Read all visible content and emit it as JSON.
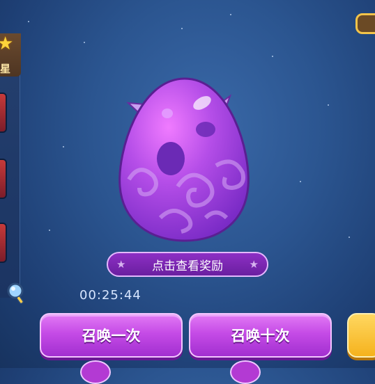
{
  "side_panel": {
    "label": "星"
  },
  "egg": {
    "name": "purple-egg"
  },
  "reward": {
    "label": "点击查看奖励"
  },
  "timer": {
    "value": "00:25:44"
  },
  "buttons": {
    "summon_once": "召唤一次",
    "summon_ten": "召唤十次"
  },
  "colors": {
    "accent": "#c54be6",
    "gold": "#f5b21d"
  }
}
